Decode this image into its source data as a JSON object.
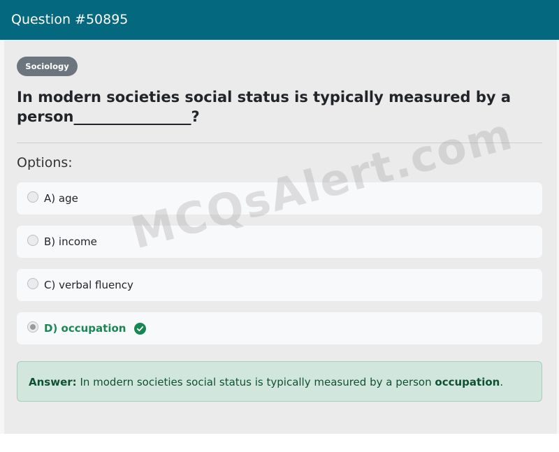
{
  "header": {
    "title": "Question #50895"
  },
  "category_badge": "Sociology",
  "question": {
    "text": "In modern societies social status is typically measured by a person________________?"
  },
  "options_label": "Options:",
  "options": [
    {
      "label": "A) age",
      "selected": false,
      "correct": false
    },
    {
      "label": "B) income",
      "selected": false,
      "correct": false
    },
    {
      "label": "C) verbal fluency",
      "selected": false,
      "correct": false
    },
    {
      "label": "D) occupation",
      "selected": true,
      "correct": true
    }
  ],
  "answer": {
    "prefix": "Answer:",
    "sentence": "In modern societies social status is typically measured by a person",
    "answer_word": "occupation",
    "suffix": "."
  },
  "watermark": "MCQsAlert.com",
  "colors": {
    "header_bg": "#04687e",
    "badge_bg": "#6c757d",
    "correct_green": "#198754",
    "answer_bg": "#d1e7dd"
  },
  "icons": {
    "correct_mark": "check-circle-icon"
  }
}
